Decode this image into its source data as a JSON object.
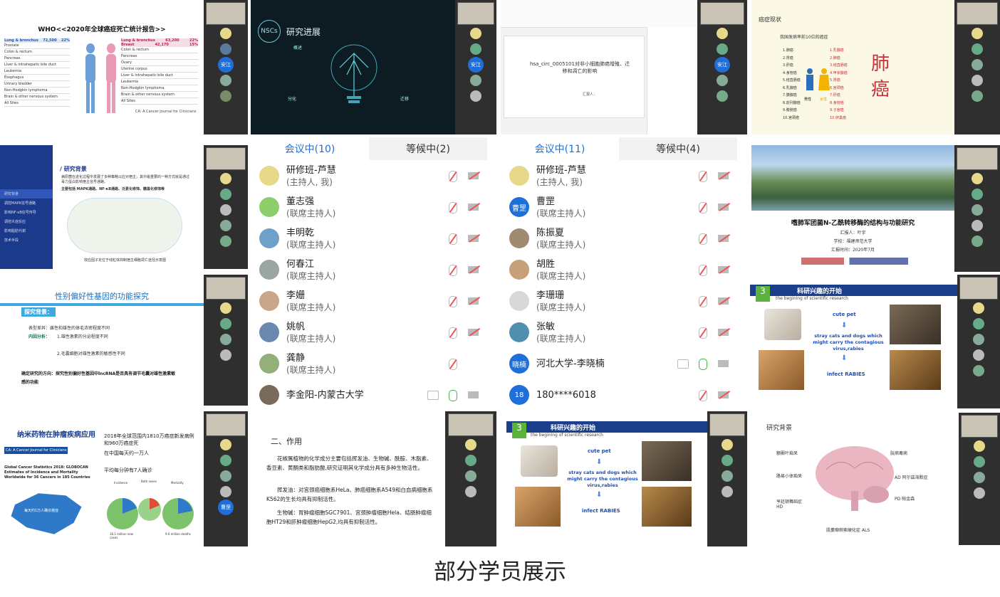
{
  "caption": "部分学员展示",
  "tiles": {
    "t1": {
      "title": "WHO<<2020年全球癌症死亡统计报告>>",
      "left_head": "Lung & bronchus",
      "left_head_val": "72,500",
      "left_head_pct": "22%",
      "right_head": "Lung & bronchus",
      "right_head_val": "63,200",
      "right_head_pct": "22%",
      "right_sub": "Breast",
      "right_sub_val": "42,170",
      "right_sub_pct": "15%",
      "left_rows": [
        "Prostate",
        "Colon & rectum",
        "Pancreas",
        "Liver & intrahepatic bile duct",
        "Leukemia",
        "Esophagus",
        "Urinary bladder",
        "Non-Hodgkin lymphoma",
        "Brain & other nervous system",
        "All Sites"
      ],
      "right_rows": [
        "Colon & rectum",
        "Pancreas",
        "Ovary",
        "Uterine corpus",
        "Liver & intrahepatic bile duct",
        "Leukemia",
        "Non-Hodgkin lymphoma",
        "Brain & other nervous system",
        "All Sites"
      ],
      "source": "CA: A Cancer Journal for Clinicians"
    },
    "t2": {
      "logo": "NSCs",
      "title": "研究进展",
      "label_a": "概述",
      "label_b": "分化",
      "label_c": "迁移"
    },
    "t3": {
      "title": "hsa_circ_0005101对非小细胞肺癌增殖、迁移和凋亡的影响",
      "reporter": "汇报人："
    },
    "t4": {
      "header": "癌症现状",
      "subtitle": "我国发病率前10位的癌症",
      "big": "肺\n癌",
      "left_list": [
        "1.肺癌",
        "2.胃癌",
        "3.肝癌",
        "4.食管癌",
        "5.结直肠癌",
        "6.乳腺癌",
        "7.胰腺癌",
        "8.前列腺癌",
        "9.膀胱癌",
        "10.宫颈癌"
      ],
      "right_list": [
        "1.乳腺癌",
        "2.肺癌",
        "3.结直肠癌",
        "4.甲状腺癌",
        "5.胃癌",
        "6.宫颈癌",
        "7.肝癌",
        "8.食管癌",
        "9.子宫癌",
        "10.卵巢癌"
      ],
      "male": "男性",
      "female": "女性"
    },
    "t5": {
      "title": "/ 研究背景",
      "menu": [
        "研究背景",
        "调控MAPK信号通路",
        "影响NF-κB信号传导",
        "调控炎症反应",
        "影响脂肪代谢",
        "技术手段"
      ],
      "bullet1": "病原菌在进化过程中发展了多种策略以应对宿主，其中最重要的一种方式就是通过毒力蛋白影响宿主信号通路。",
      "bullet2": "主要包括 MAPK通路、NF-κB通路、泛素化修饰、糖基化修饰等",
      "caption": "效应因子定位于线粒体抑制宿主细胞凋亡途径示意图"
    },
    "t6": {
      "title": "性别偏好性基因的功能探究",
      "h1": "探究背景：",
      "b1": "表型差异：雌性和雄性的体毛浓密程度不同",
      "b2": "内因分析：",
      "b2a": "1.雄性激素的分泌程度不同",
      "b2b": "2.毛囊细胞对雄性激素的敏感性不同",
      "b3": "确定研究的方向：探究性别偏好性基因中lncRNA是否具有调节毛囊对雄性激素敏感的功能"
    },
    "t7": {
      "title": "纳米药物在肿瘤疾病应用",
      "journal": "CA: A Cancer Journal for Clinicians",
      "paper": "Global Cancer Statistics 2018: GLOBOCAN Estimates of Incidence and Mortality Worldwide for 36 Cancers in 185 Countries",
      "b1": "2018年全球范围内1810万癌症新发病例和960万癌症死",
      "b2": "在中国每天约一万人",
      "b3": "平均每分钟有7人确诊",
      "map_label": "每天约1万人确诊癌症",
      "pie1": "Incidence",
      "pie2": "Both sexes",
      "pie3": "Mortality",
      "n1": "18.1 million new cases",
      "n2": "9.6 million deaths"
    },
    "t8": {
      "title": "二、作用",
      "p1": "花椒属植物的化学成分主要包括挥发油、生物碱、酰胺、木脂素、香豆素、黄酮类和脂肪酸,研究证明其化学成分具有多种生物活性。",
      "p2": "挥发油：对宫颈癌细胞系HeLa、肺癌细胞系A549和白血病细胞系K562的生长均具有抑制活性。",
      "p3": "生物碱：胃肿瘤细胞SGC7901、宫颈肿瘤细胞Hela、结肠肿瘤细胞HT29和肝肿瘤细胞HepG2,均具有抑制活性。"
    },
    "t9": {
      "num": "3",
      "title": "科研兴趣的开始",
      "subtitle": "the begining of scientific research",
      "cute": "cute pet",
      "stray": "stray cats and dogs which might carry the contagious virus,rabies",
      "infect": "infect RABIES"
    },
    "t10": {
      "title": "嗜肺军团菌N-乙酰转移酶的结构与功能研究",
      "l1": "汇报人：叶宇",
      "l2": "学校：福建师范大学",
      "l3": "汇报时间：2020年7月"
    },
    "t11": {
      "num": "3",
      "title": "科研兴趣的开始",
      "subtitle": "the begining of scientific research",
      "cute": "cute pet",
      "stray": "stray cats and dogs which might carry the contagious virus,rabies",
      "infect": "infect RABIES"
    },
    "t12": {
      "title": "研究背景",
      "a": "朊病毒病",
      "b": "额颞叶痴呆",
      "c": "路易小体痴呆",
      "d": "AD 阿尔兹海默症",
      "e": "PD 帕金森",
      "f": "亨廷顿舞蹈症 HD",
      "g": "肌萎缩侧索硬化症 ALS"
    }
  },
  "panel1": {
    "tab_active": "会议中(10)",
    "tab_wait": "等候中(2)",
    "rows": [
      {
        "name": "研修班-芦慧",
        "role": "(主持人, 我)"
      },
      {
        "name": "董志强",
        "role": "(联席主持人)"
      },
      {
        "name": "丰明乾",
        "role": "(联席主持人)"
      },
      {
        "name": "何春江",
        "role": "(联席主持人)"
      },
      {
        "name": "李姗",
        "role": "(联席主持人)"
      },
      {
        "name": "姚帆",
        "role": "(联席主持人)"
      },
      {
        "name": "龚静",
        "role": "(联席主持人)"
      },
      {
        "name": "李金阳-内蒙古大学",
        "role": ""
      }
    ]
  },
  "panel2": {
    "tab_active": "会议中(11)",
    "tab_wait": "等候中(4)",
    "rows": [
      {
        "name": "研修班-芦慧",
        "role": "(主持人, 我)",
        "avatar": ""
      },
      {
        "name": "曹罡",
        "role": "(联席主持人)",
        "avatar": "曹罡"
      },
      {
        "name": "陈振夏",
        "role": "(联席主持人)",
        "avatar": ""
      },
      {
        "name": "胡胜",
        "role": "(联席主持人)",
        "avatar": ""
      },
      {
        "name": "李珊珊",
        "role": "(联席主持人)",
        "avatar": ""
      },
      {
        "name": "张敏",
        "role": "(联席主持人)",
        "avatar": ""
      },
      {
        "name": "河北大学-李晓楠",
        "role": "",
        "avatar": "晓楠"
      },
      {
        "name": "180****6018",
        "role": "",
        "avatar": "18"
      }
    ]
  },
  "strip_labels": {
    "anjiang": "安江",
    "caogang": "曹罡"
  },
  "colors": {
    "blue": "#1e6fd9",
    "dark": "#2f2f2f",
    "red": "#d3303a"
  }
}
